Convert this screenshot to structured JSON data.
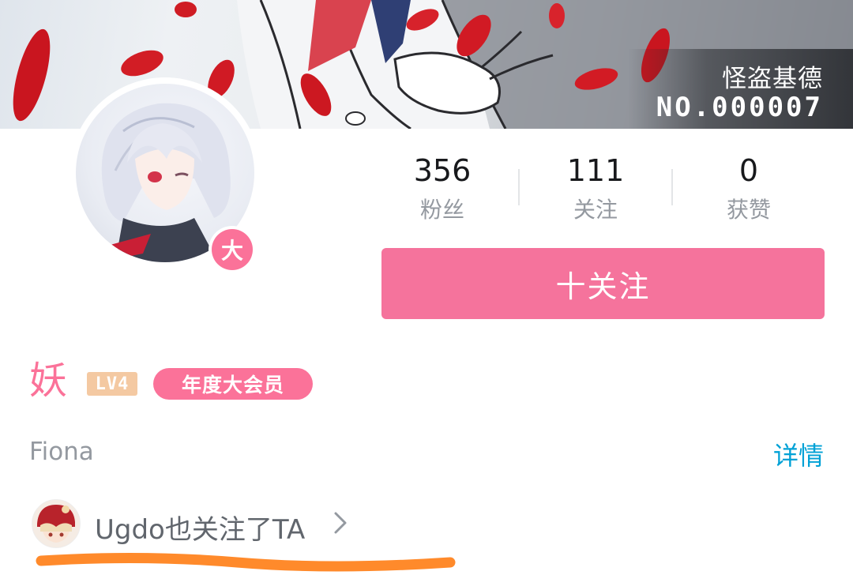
{
  "banner": {
    "title": "怪盗基德",
    "number": "NO.000007"
  },
  "profile": {
    "vip_badge_char": "大",
    "nickname": "妖",
    "level": "LV4",
    "vip_label": "年度大会员",
    "sign": "Fiona",
    "detail_label": "详情"
  },
  "stats": [
    {
      "value": "356",
      "label": "粉丝"
    },
    {
      "value": "111",
      "label": "关注"
    },
    {
      "value": "0",
      "label": "获赞"
    }
  ],
  "follow_button": {
    "label": "十关注"
  },
  "followed_by": {
    "text": "Ugdo也关注了TA"
  },
  "colors": {
    "pink": "#fb7299",
    "button": "#f5739c",
    "link": "#00a1d6",
    "annotation": "#ff8a2b"
  }
}
